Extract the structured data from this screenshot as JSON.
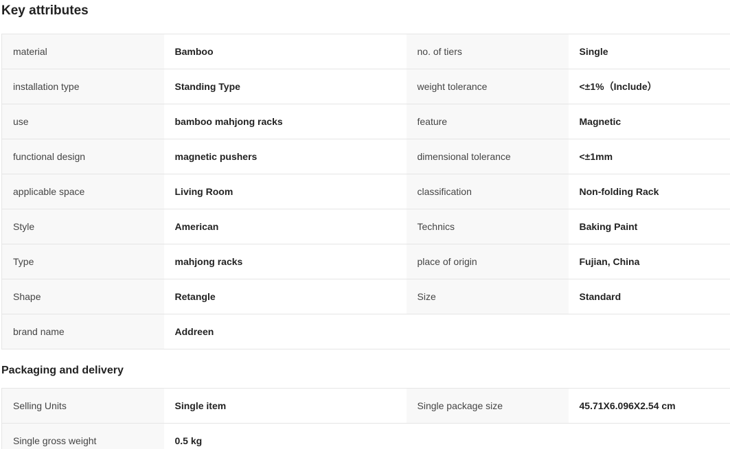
{
  "key_attributes": {
    "title": "Key attributes",
    "rows": [
      {
        "l1": "material",
        "v1": "Bamboo",
        "l2": "no. of tiers",
        "v2": "Single"
      },
      {
        "l1": "installation type",
        "v1": "Standing Type",
        "l2": "weight tolerance",
        "v2": "<±1%（Include）"
      },
      {
        "l1": "use",
        "v1": "bamboo mahjong racks",
        "l2": "feature",
        "v2": "Magnetic"
      },
      {
        "l1": "functional design",
        "v1": "magnetic pushers",
        "l2": "dimensional tolerance",
        "v2": "<±1mm"
      },
      {
        "l1": "applicable space",
        "v1": "Living Room",
        "l2": "classification",
        "v2": "Non-folding Rack"
      },
      {
        "l1": "Style",
        "v1": "American",
        "l2": "Technics",
        "v2": "Baking Paint"
      },
      {
        "l1": "Type",
        "v1": "mahjong racks",
        "l2": "place of origin",
        "v2": "Fujian, China"
      },
      {
        "l1": "Shape",
        "v1": "Retangle",
        "l2": "Size",
        "v2": "Standard"
      },
      {
        "l1": "brand name",
        "v1": "Addreen",
        "l2": "",
        "v2": ""
      }
    ]
  },
  "packaging": {
    "title": "Packaging and delivery",
    "rows": [
      {
        "l1": "Selling Units",
        "v1": "Single item",
        "l2": "Single package size",
        "v2": "45.71X6.096X2.54 cm"
      },
      {
        "l1": "Single gross weight",
        "v1": "0.5 kg",
        "l2": "",
        "v2": ""
      }
    ]
  }
}
